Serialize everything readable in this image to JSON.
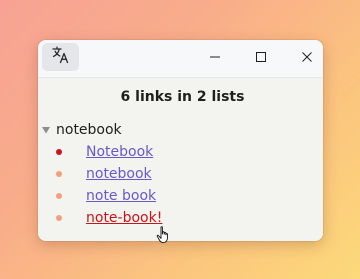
{
  "heading": "6 links in 2 lists",
  "group": {
    "label": "notebook"
  },
  "links": [
    {
      "text": "Notebook",
      "bullet_color": "#c8141a",
      "link_color": "#6a58c8"
    },
    {
      "text": "notebook",
      "bullet_color": "#f2a07e",
      "link_color": "#6a58c8"
    },
    {
      "text": "note book",
      "bullet_color": "#f2a07e",
      "link_color": "#6a58c8"
    },
    {
      "text": "note-book!",
      "bullet_color": "#f2a07e",
      "link_color": "#c8141a"
    }
  ],
  "icons": {
    "translate": "translate-icon",
    "minimize": "minimize-icon",
    "maximize": "maximize-icon",
    "close": "close-icon",
    "disclosure": "triangle-down-icon",
    "cursor": "hand-pointer-icon"
  }
}
